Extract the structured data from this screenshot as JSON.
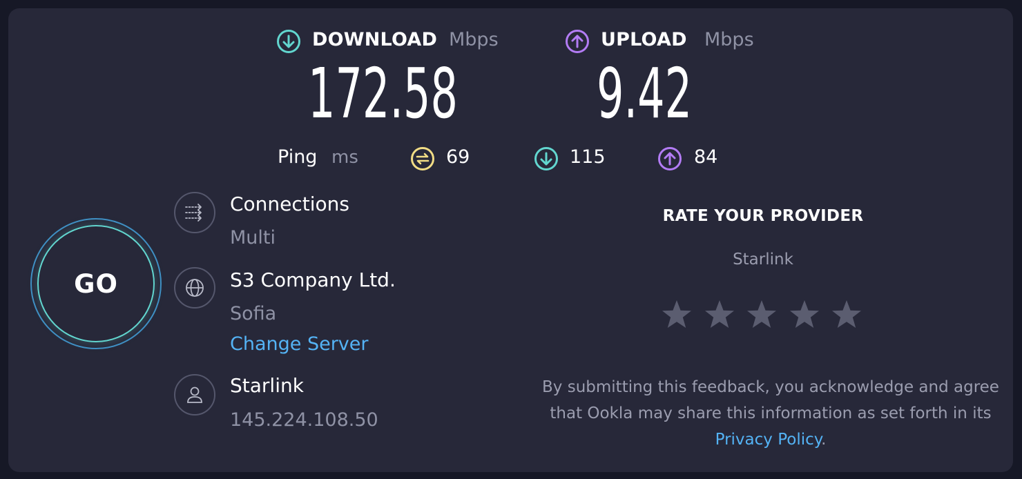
{
  "download": {
    "label": "DOWNLOAD",
    "unit": "Mbps",
    "value": "172.58",
    "icon": "arrow-down-circle-icon",
    "color": "#62d6cf"
  },
  "upload": {
    "label": "UPLOAD",
    "unit": "Mbps",
    "value": "9.42",
    "icon": "arrow-up-circle-icon",
    "color": "#b37cf5"
  },
  "ping": {
    "label": "Ping",
    "unit": "ms",
    "idle": {
      "value": "69",
      "icon": "ping-idle-icon",
      "color": "#f2dd85"
    },
    "download": {
      "value": "115",
      "icon": "arrow-down-circle-icon",
      "color": "#62d6cf"
    },
    "upload": {
      "value": "84",
      "icon": "arrow-up-circle-icon",
      "color": "#b37cf5"
    }
  },
  "go_button": {
    "label": "GO"
  },
  "connections": {
    "title": "Connections",
    "value": "Multi",
    "icon": "connections-icon"
  },
  "server": {
    "name": "S3 Company Ltd.",
    "location": "Sofia",
    "change_label": "Change Server",
    "icon": "globe-icon"
  },
  "isp": {
    "name": "Starlink",
    "ip": "145.224.108.50",
    "icon": "user-icon"
  },
  "rating": {
    "title": "RATE YOUR PROVIDER",
    "provider": "Starlink",
    "stars": 5,
    "selected": 0,
    "disclaimer_text": "By submitting this feedback, you acknowledge and agree that Ookla may share this information as set forth in its",
    "privacy_label": "Privacy Policy",
    "trailing": "."
  }
}
